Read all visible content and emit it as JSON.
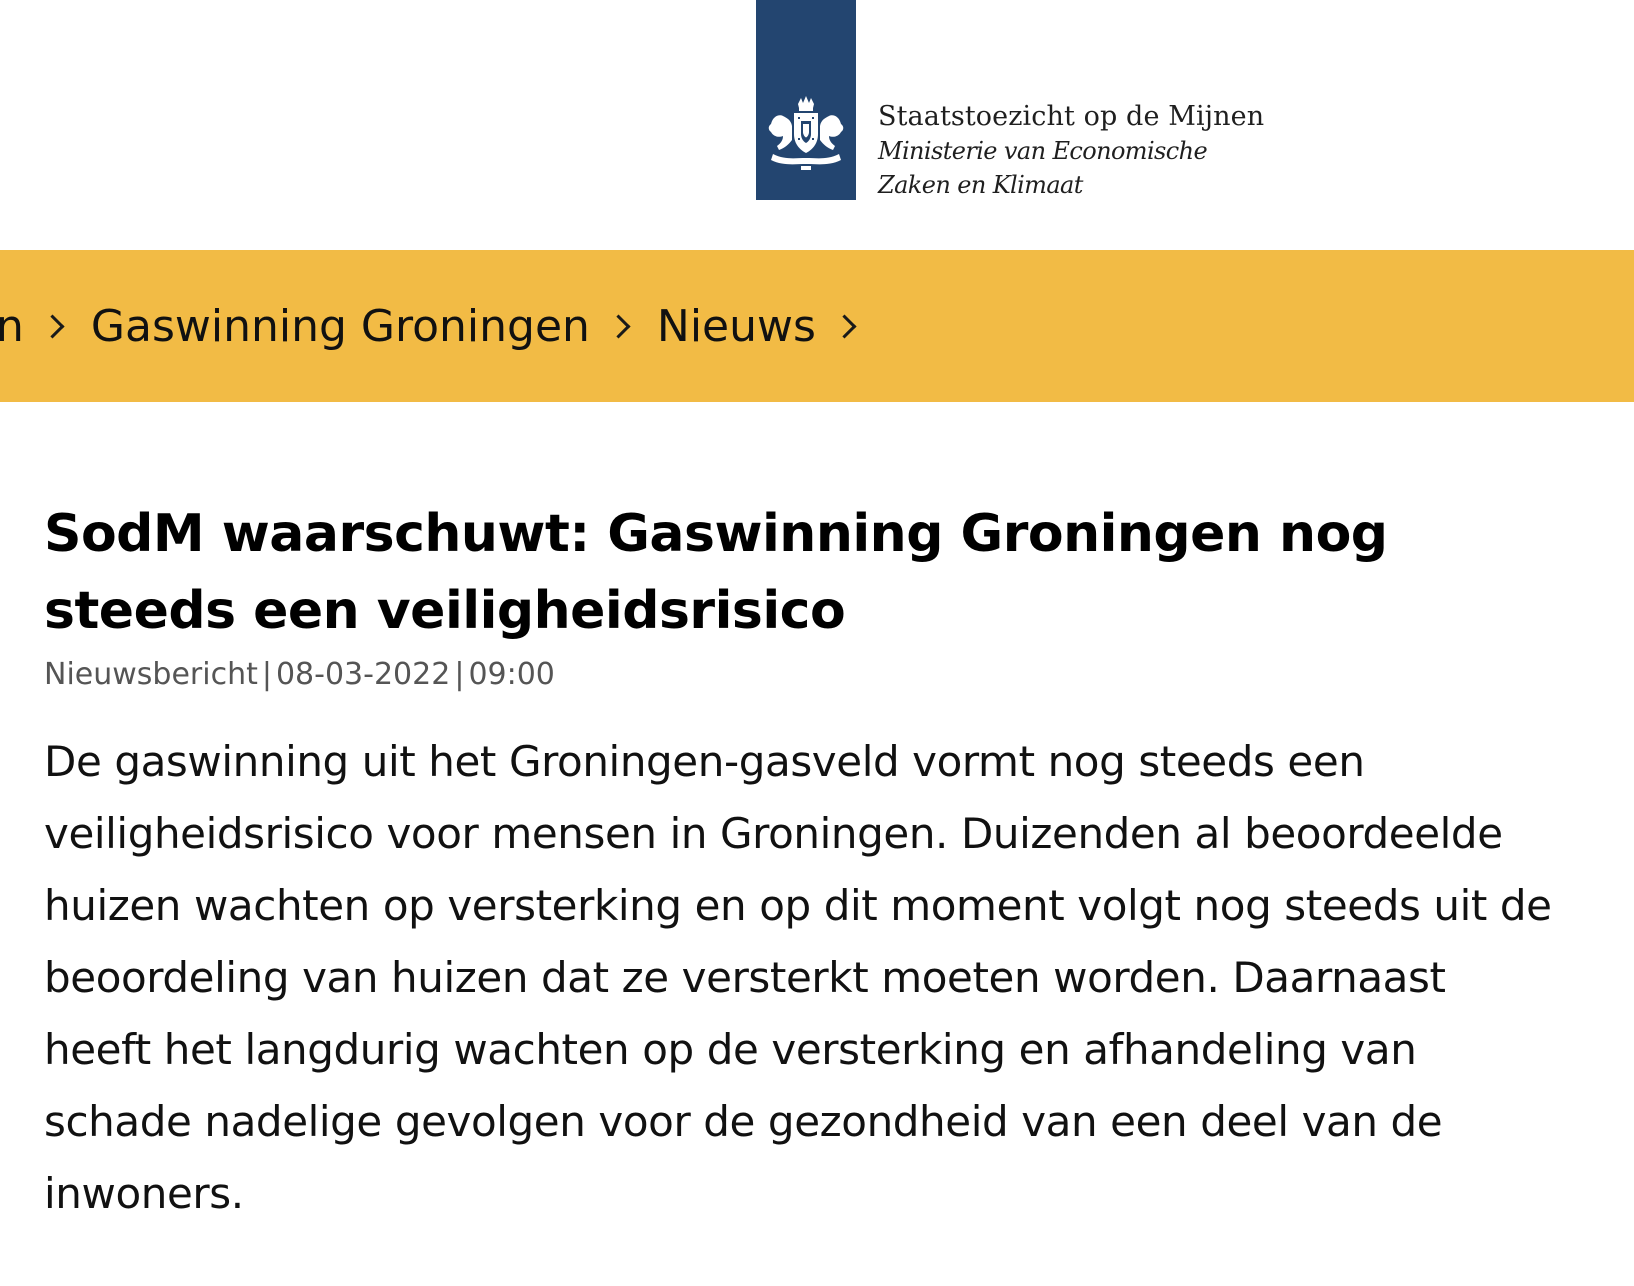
{
  "header": {
    "logo": {
      "organisation": "Staatstoezicht op de Mijnen",
      "ministry": "Ministerie van Economische Zaken en Klimaat",
      "brand_color": "#234570",
      "icon": "coat-of-arms-icon"
    }
  },
  "breadcrumb": {
    "background_color": "#f2bb45",
    "items": [
      {
        "label": "n"
      },
      {
        "label": "Gaswinning Groningen"
      },
      {
        "label": "Nieuws"
      }
    ],
    "separator_icon": "chevron-right-icon"
  },
  "article": {
    "title": "SodM waarschuwt: Gaswinning Groningen nog steeds een veiligheidsrisico",
    "meta": {
      "type": "Nieuwsbericht",
      "separator": "|",
      "date": "08-03-2022",
      "time": "09:00"
    },
    "lead": "De gaswinning uit het Groningen-gasveld vormt nog steeds een veiligheidsrisico voor mensen in Groningen. Duizenden al beoordeelde huizen wachten op versterking en op dit moment volgt nog steeds uit de beoordeling van huizen dat ze versterkt moeten worden. Daarnaast heeft het langdurig wachten op de versterking en afhandeling van schade nadelige gevolgen voor de gezondheid van een deel van de inwoners."
  }
}
